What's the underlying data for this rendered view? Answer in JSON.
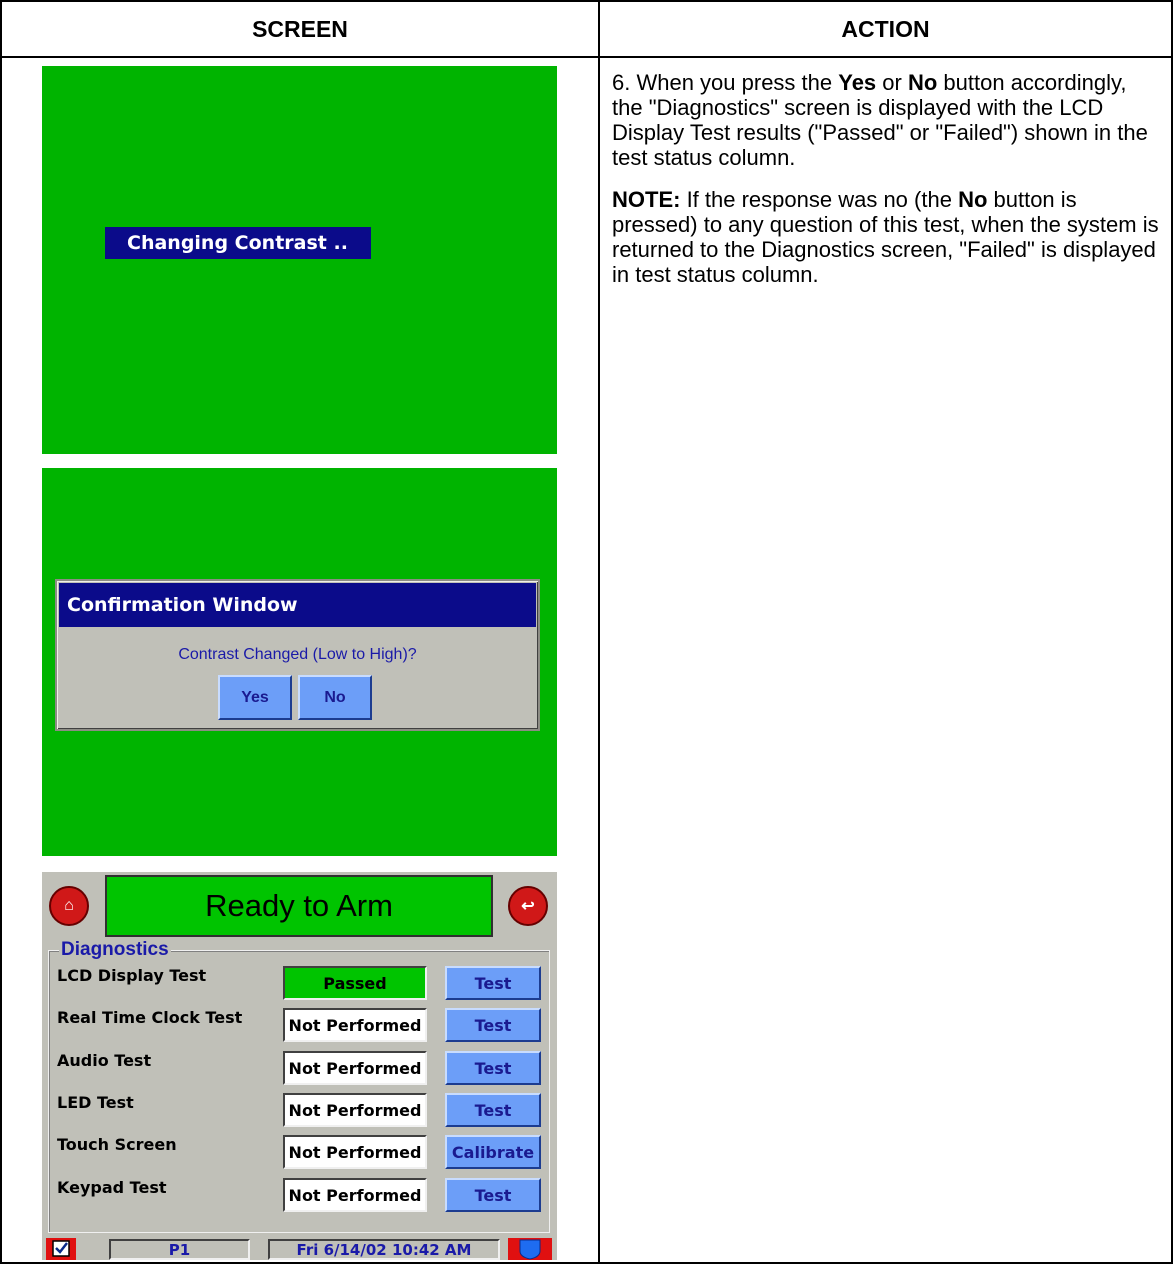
{
  "table": {
    "header_screen": "SCREEN",
    "header_action": "ACTION"
  },
  "action": {
    "step_prefix": "6.  When you press the ",
    "yes": "Yes",
    "or": " or ",
    "no": "No",
    "step_suffix": " button accordingly, the \"Diagnostics\" screen is displayed with the LCD Display Test results (\"Passed\" or \"Failed\") shown in the test status column.",
    "note_label": "NOTE:",
    "note_prefix": "  If the response was no (the ",
    "note_no": "No",
    "note_suffix": " button is pressed) to any question of this test, when the system is returned to the Diagnostics screen, \"Failed\" is displayed in test status column."
  },
  "screen1": {
    "banner": "Changing Contrast .."
  },
  "screen2": {
    "title": "Confirmation Window",
    "message": "Contrast Changed (Low to High)?",
    "yes_label": "Yes",
    "no_label": "No"
  },
  "screen3": {
    "status": "Ready to Arm",
    "home_icon_glyph": "⌂",
    "back_icon_glyph": "↩",
    "group_title": "Diagnostics",
    "rows": [
      {
        "label": "LCD Display Test",
        "status": "Passed",
        "button": "Test"
      },
      {
        "label": "Real Time Clock Test",
        "status": "Not Performed",
        "button": "Test"
      },
      {
        "label": "Audio Test",
        "status": "Not Performed",
        "button": "Test"
      },
      {
        "label": "LED Test",
        "status": "Not Performed",
        "button": "Test"
      },
      {
        "label": "Touch Screen",
        "status": "Not Performed",
        "button": "Calibrate"
      },
      {
        "label": "Keypad Test",
        "status": "Not Performed",
        "button": "Test"
      }
    ],
    "partition": "P1",
    "datetime": "Fri 6/14/02 10:42 AM"
  },
  "colors": {
    "screen_green": "#00b400",
    "title_blue": "#0b0b8a",
    "button_blue": "#6c9ef8",
    "panel_gray": "#c0c0b8"
  }
}
